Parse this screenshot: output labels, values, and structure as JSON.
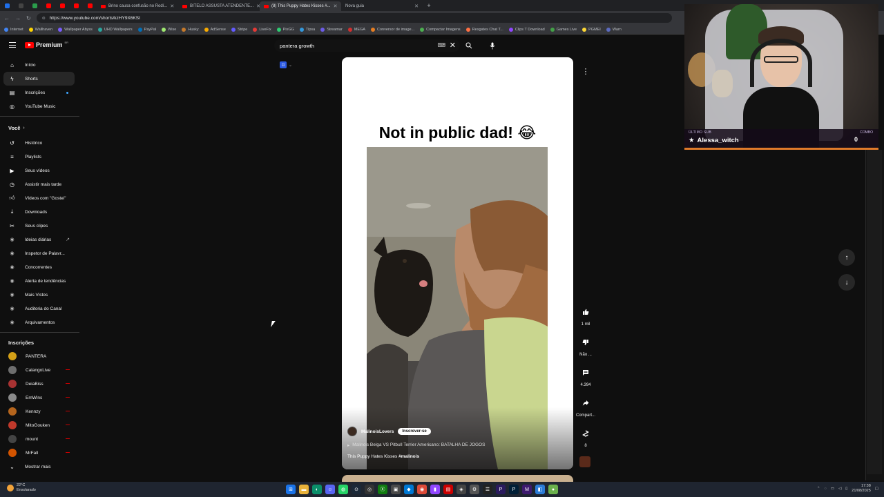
{
  "browser": {
    "tabs": [
      {
        "title": "Brino causa confusão no Rodí...",
        "favicon_color": "#ff0000",
        "active": false
      },
      {
        "title": "BITELO ASSUSTA ATENDENTE...",
        "favicon_color": "#ff0000",
        "active": false
      },
      {
        "title": "(8) This Puppy Hates Kisses #...",
        "favicon_color": "#ff0000",
        "active": true
      },
      {
        "title": "Nova guia",
        "favicon_color": "#9aa0a6",
        "active": false
      }
    ],
    "url": "https://www.youtube.com/shorts/kzHY9X6KSI",
    "bookmarks": [
      "Internet",
      "Wallhaven",
      "Wallpaper Abyss",
      "UHD Wallpapers",
      "PayPal",
      "Wise",
      "Husky",
      "AdSense",
      "Stripe",
      "LiveFix",
      "PixGG",
      "Tipsa",
      "Streamar",
      "MEGA",
      "Conversor de image...",
      "Compactar Imagens",
      "Resgates Chat T...",
      "Clips T Download",
      "Games Live",
      "PGMEI",
      "Warn"
    ]
  },
  "header": {
    "logo_text": "Premium",
    "logo_region": "BR",
    "search_value": "pantera growth"
  },
  "sidebar": {
    "main": [
      {
        "label": "Início",
        "icon": "home-icon"
      },
      {
        "label": "Shorts",
        "icon": "shorts-icon",
        "active": true
      },
      {
        "label": "Inscrições",
        "icon": "subscriptions-icon",
        "dot": true
      }
    ],
    "music": {
      "label": "YouTube Music",
      "icon": "music-icon"
    },
    "you_section": "Você",
    "you_items": [
      {
        "label": "Histórico",
        "icon": "history-icon"
      },
      {
        "label": "Playlists",
        "icon": "playlist-icon"
      },
      {
        "label": "Seus vídeos",
        "icon": "videos-icon"
      },
      {
        "label": "Assistir mais tarde",
        "icon": "clock-icon"
      },
      {
        "label": "Vídeos com \"Gostei\"",
        "icon": "like-icon"
      },
      {
        "label": "Downloads",
        "icon": "download-icon"
      },
      {
        "label": "Seus clipes",
        "icon": "scissors-icon"
      },
      {
        "label": "Ideias diárias",
        "icon": "ext-icon",
        "external": true
      },
      {
        "label": "Inspetor de Palavr...",
        "icon": "ext-icon"
      },
      {
        "label": "Concorrentes",
        "icon": "ext-icon"
      },
      {
        "label": "Alerta de tendências",
        "icon": "ext-icon"
      },
      {
        "label": "Mais Vistos",
        "icon": "ext-icon"
      },
      {
        "label": "Auditoria do Canal",
        "icon": "ext-icon"
      },
      {
        "label": "Arquivamentos",
        "icon": "ext-icon"
      }
    ],
    "subs_section": "Inscrições",
    "subscriptions": [
      {
        "label": "PANTERA",
        "color": "#d4a017",
        "live": false
      },
      {
        "label": "CalangoLive",
        "color": "#6e6e6e",
        "live": true
      },
      {
        "label": "DeiaBiss",
        "color": "#a83232",
        "live": true
      },
      {
        "label": "EmWins",
        "color": "#8a8a8a",
        "live": true
      },
      {
        "label": "Kennzy",
        "color": "#b5651d",
        "live": true
      },
      {
        "label": "MitoGouken",
        "color": "#c0392b",
        "live": true
      },
      {
        "label": "mount",
        "color": "#444444",
        "live": true
      },
      {
        "label": "MrFall",
        "color": "#d35400",
        "live": true
      }
    ],
    "show_more": "Mostrar mais"
  },
  "short": {
    "title": "Not in public dad! 😂",
    "channel": "MalinoisLovers",
    "subscribe_label": "Inscrever-se",
    "related": "Malinois Belga VS Pitbull Terrier Americano: BATALHA DE JOGOS",
    "caption": "This Puppy Hates Kisses",
    "hashtag": "#malinois"
  },
  "actions": {
    "likes": "1 mil",
    "dislike_label": "Não ...",
    "comments": "4.394",
    "share_label": "Compart...",
    "remix_count": "8"
  },
  "overlay": {
    "last_sub_label": "ÚLTIMO SUB",
    "last_sub_name": "Alessa_witch",
    "combo_label": "COMBO",
    "combo_value": "0"
  },
  "taskbar": {
    "temperature": "22°C",
    "weather": "Ensolarado",
    "time": "17:38",
    "date": "21/08/2025"
  }
}
